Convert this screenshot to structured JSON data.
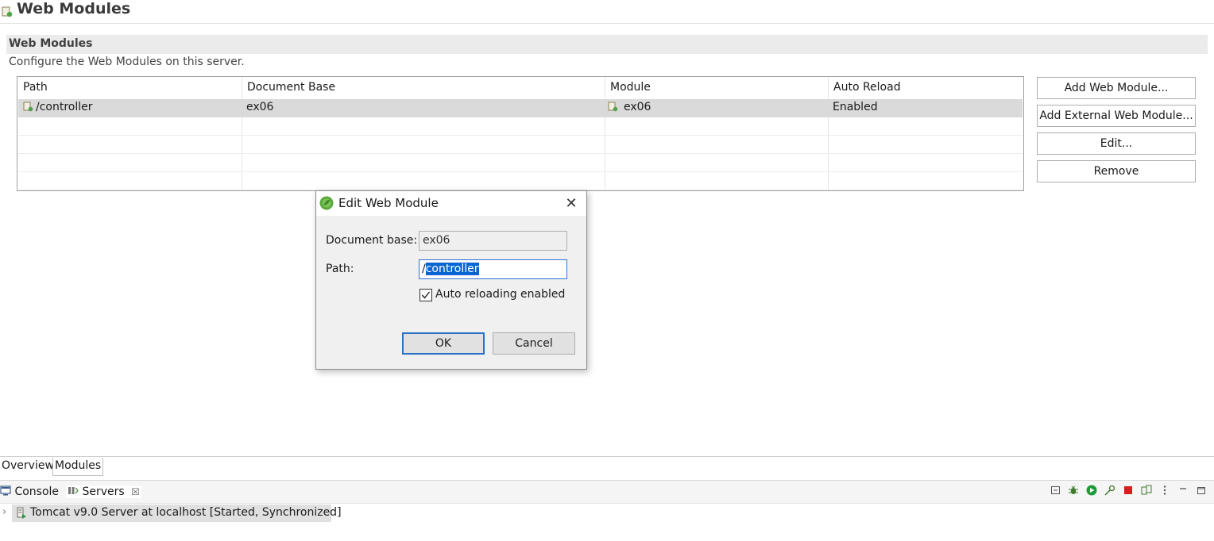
{
  "header": {
    "title": "Web Modules"
  },
  "section": {
    "title": "Web Modules",
    "description": "Configure the Web Modules on this server."
  },
  "table": {
    "columns": [
      "Path",
      "Document Base",
      "Module",
      "Auto Reload"
    ],
    "rows": [
      {
        "path": "/controller",
        "document_base": "ex06",
        "module": "ex06",
        "auto_reload": "Enabled"
      }
    ]
  },
  "side_buttons": {
    "add_web_module": "Add Web Module...",
    "add_external": "Add External Web Module...",
    "edit": "Edit...",
    "remove": "Remove"
  },
  "dialog": {
    "title": "Edit Web Module",
    "close_glyph": "✕",
    "document_base_label": "Document base:",
    "document_base_value": "ex06",
    "path_label": "Path:",
    "path_prefix": "/",
    "path_selected": "controller",
    "auto_reload_label": "Auto reloading enabled",
    "auto_reload_checked": true,
    "ok": "OK",
    "cancel": "Cancel"
  },
  "editor_tabs": {
    "overview": "Overview",
    "modules": "Modules"
  },
  "views": {
    "console": "Console",
    "servers": "Servers",
    "servers_close": "☒"
  },
  "servers_tree": {
    "chevron": "›",
    "label": "Tomcat v9.0 Server at localhost  [Started, Synchronized]"
  },
  "colors": {
    "selection_blue": "#0a64d2",
    "focus_border": "#2c73d2",
    "stop_red": "#d71f1f",
    "run_green": "#1f9a38"
  }
}
